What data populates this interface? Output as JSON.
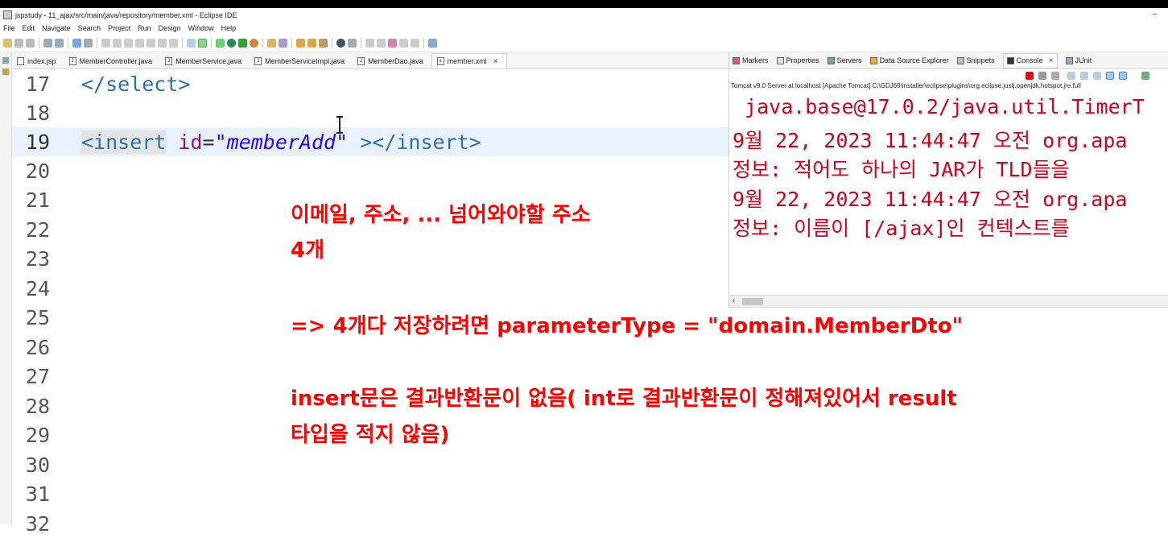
{
  "window": {
    "title": "jspstudy - 11_ajax/src/main/java/repository/member.xml - Eclipse IDE",
    "minimize_glyph": "–"
  },
  "menu": [
    "File",
    "Edit",
    "Navigate",
    "Search",
    "Project",
    "Run",
    "Design",
    "Window",
    "Help"
  ],
  "editor_tabs": [
    {
      "label": "index.jsp",
      "icon": "jsp-file-icon"
    },
    {
      "label": "MemberController.java",
      "icon": "java-file-icon"
    },
    {
      "label": "MemberService.java",
      "icon": "java-file-icon"
    },
    {
      "label": "MemberServiceImpl.java",
      "icon": "java-file-icon"
    },
    {
      "label": "MemberDao.java",
      "icon": "java-file-icon"
    },
    {
      "label": "member.xml",
      "icon": "xml-file-icon",
      "active": true
    }
  ],
  "code": {
    "line_numbers": [
      "17",
      "18",
      "19",
      "20",
      "21",
      "22",
      "23",
      "24",
      "25",
      "26",
      "27",
      "28",
      "29",
      "30",
      "31",
      "32"
    ],
    "line17": "</select>",
    "line19": {
      "open_tag": "<insert",
      "attr": "id",
      "eq": "=",
      "value": "\"memberAdd\"",
      "close": " ></insert>"
    }
  },
  "annotations": {
    "a1": "이메일, 주소, ... 넘어와야할 주소",
    "a2": "4개",
    "a3": "=> 4개다 저장하려면 parameterType = \"domain.MemberDto\"",
    "a4": "insert문은 결과반환문이 없음( int로 결과반환문이 정해져있어서 result",
    "a5": "타입을 적지 않음)"
  },
  "console_tabs": [
    {
      "label": "Markers"
    },
    {
      "label": "Properties"
    },
    {
      "label": "Servers"
    },
    {
      "label": "Data Source Explorer"
    },
    {
      "label": "Snippets"
    },
    {
      "label": "Console",
      "active": true,
      "close": "×"
    },
    {
      "label": "JUnit"
    }
  ],
  "console": {
    "server_line": "Tomcat v9.0 Server at localhost [Apache Tomcat] C:\\GDJ69\\installer\\eclipse\\plugins\\org.eclipse.justj.openjdk.hotspot.jre.full",
    "lines": [
      " java.base@17.0.2/java.util.TimerT",
      "9월 22, 2023 11:44:47 오전 org.apa",
      "정보: 적어도 하나의 JAR가 TLD들을",
      "9월 22, 2023 11:44:47 오전 org.apa",
      "정보: 이름이 [/ajax]인 컨텍스트를"
    ]
  },
  "colors": {
    "annotation": "#ff0000",
    "console_text": "#d0021b",
    "line_highlight": "#e8f2fe",
    "attr_value": "#2a00ff",
    "tag": "#2f6fa8"
  }
}
